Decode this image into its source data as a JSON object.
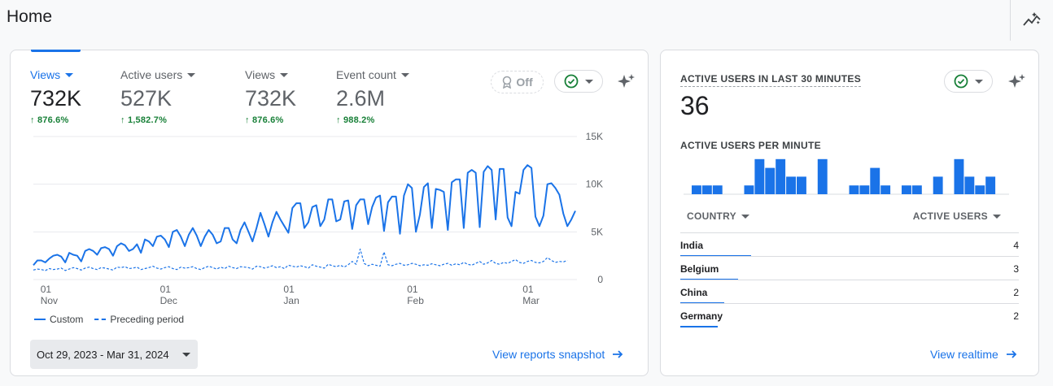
{
  "page": {
    "title": "Home"
  },
  "main": {
    "metrics": [
      {
        "label": "Views",
        "value": "732K",
        "change": "876.6%",
        "active": true
      },
      {
        "label": "Active users",
        "value": "527K",
        "change": "1,582.7%"
      },
      {
        "label": "Views",
        "value": "732K",
        "change": "876.6%"
      },
      {
        "label": "Event count",
        "value": "2.6M",
        "change": "988.2%"
      }
    ],
    "off_label": "Off",
    "legend": {
      "current": "Custom",
      "previous": "Preceding period"
    },
    "date_range": "Oct 29, 2023 - Mar 31, 2024",
    "snapshot_link": "View reports snapshot"
  },
  "chart_data": {
    "type": "line",
    "yticks": [
      "15K",
      "10K",
      "5K",
      "0"
    ],
    "ylim": [
      0,
      15000
    ],
    "xticks": [
      {
        "day": "01",
        "month": "Nov"
      },
      {
        "day": "01",
        "month": "Dec"
      },
      {
        "day": "01",
        "month": "Jan"
      },
      {
        "day": "01",
        "month": "Feb"
      },
      {
        "day": "01",
        "month": "Mar"
      }
    ],
    "series": [
      {
        "name": "Custom",
        "style": "solid",
        "color": "#1a73e8",
        "values": [
          1500,
          2000,
          2000,
          1800,
          2200,
          2500,
          2600,
          2400,
          1800,
          2800,
          2600,
          2500,
          1900,
          3000,
          3200,
          3000,
          2600,
          3300,
          3400,
          3200,
          2500,
          3500,
          3800,
          3600,
          3000,
          3200,
          3700,
          2800,
          4200,
          4000,
          3500,
          4500,
          4600,
          4200,
          3400,
          5000,
          5200,
          4500,
          3500,
          4700,
          5400,
          4600,
          3500,
          4500,
          5200,
          4700,
          3800,
          4000,
          5400,
          5400,
          4200,
          3800,
          5200,
          6000,
          5000,
          4000,
          5400,
          7000,
          5800,
          4500,
          6000,
          7100,
          6300,
          5600,
          4900,
          7500,
          8000,
          8000,
          5400,
          6000,
          7600,
          7800,
          5600,
          6300,
          8400,
          8400,
          6100,
          6300,
          8200,
          8300,
          5300,
          7800,
          8400,
          8400,
          5800,
          7600,
          8600,
          8800,
          5100,
          8100,
          8700,
          8700,
          4800,
          8800,
          10000,
          9600,
          5000,
          6800,
          9700,
          10100,
          5400,
          9500,
          9400,
          9200,
          5200,
          10200,
          10500,
          10500,
          5400,
          11200,
          11500,
          11200,
          5500,
          11300,
          11900,
          11500,
          6300,
          11600,
          11600,
          6500,
          5600,
          9200,
          9000,
          11500,
          12000,
          11700,
          6600,
          5600,
          6700,
          10000,
          10100,
          9600,
          8900,
          6900,
          5600,
          6300,
          7200
        ]
      },
      {
        "name": "Preceding period",
        "style": "dashed",
        "color": "#1a73e8",
        "values": [
          1000,
          1100,
          1050,
          950,
          1150,
          1050,
          1100,
          1200,
          950,
          1100,
          1250,
          1150,
          1000,
          1200,
          1300,
          1150,
          1050,
          1250,
          1200,
          1100,
          1000,
          1300,
          1250,
          1350,
          1150,
          1200,
          1300,
          1050,
          1150,
          1250,
          1400,
          1200,
          1100,
          1250,
          1350,
          1150,
          1050,
          1300,
          1200,
          1250,
          1350,
          1150,
          1050,
          1250,
          1400,
          1250,
          1100,
          1300,
          1150,
          1400,
          1250,
          1150,
          1350,
          1300,
          1250,
          1100,
          1400,
          1350,
          1200,
          1300,
          1450,
          1250,
          1350,
          1150,
          1500,
          1400,
          1300,
          1450,
          1350,
          1200,
          1550,
          1400,
          1300,
          1200,
          1600,
          1450,
          1350,
          1500,
          1300,
          1550,
          1900,
          1600,
          3200,
          1700,
          1450,
          1600,
          1500,
          1400,
          2900,
          1550,
          1450,
          1600,
          1700,
          1500,
          1550,
          1700,
          1600,
          1450,
          1550,
          1500,
          1650,
          1550,
          1450,
          1600,
          1700,
          1500,
          1650,
          1550,
          1800,
          1600,
          1500,
          1700,
          1900,
          1600,
          1750,
          2000,
          1700,
          1600,
          1800,
          1700,
          1900,
          2100,
          1800,
          1700,
          1900,
          2000,
          1800,
          1750,
          1900,
          2300,
          2000,
          1800,
          1900,
          1850,
          2000
        ]
      }
    ]
  },
  "realtime": {
    "title": "ACTIVE USERS IN LAST 30 MINUTES",
    "count": "36",
    "per_minute_label": "ACTIVE USERS PER MINUTE",
    "per_minute": [
      1,
      1,
      1,
      0,
      0,
      1,
      4,
      3,
      4,
      2,
      2,
      0,
      4,
      0,
      0,
      1,
      1,
      3,
      1,
      0,
      1,
      1,
      0,
      2,
      0,
      4,
      2,
      1,
      2
    ],
    "col_country": "COUNTRY",
    "col_users": "ACTIVE USERS",
    "rows": [
      {
        "country": "India",
        "users": "4",
        "share": 0.21
      },
      {
        "country": "Belgium",
        "users": "3",
        "share": 0.17
      },
      {
        "country": "China",
        "users": "2",
        "share": 0.13
      },
      {
        "country": "Germany",
        "users": "2",
        "share": 0.11
      }
    ],
    "link": "View realtime"
  }
}
